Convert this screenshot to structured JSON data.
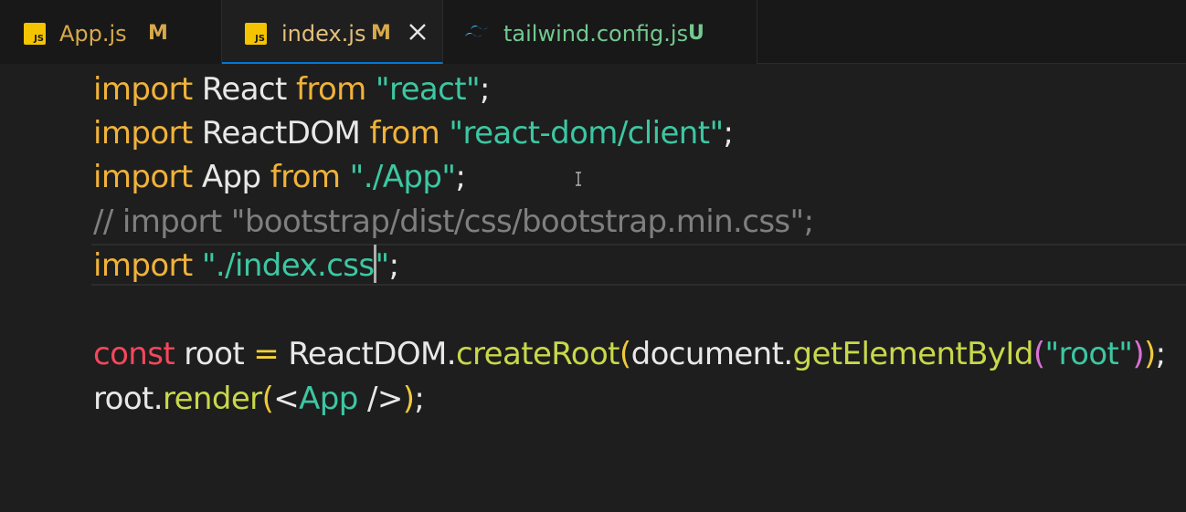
{
  "tabs": [
    {
      "label": "App.js",
      "status": "M",
      "icon": "js-icon",
      "active": false
    },
    {
      "label": "index.js",
      "status": "M",
      "icon": "js-icon",
      "active": true
    },
    {
      "label": "tailwind.config.js",
      "status": "U",
      "icon": "tailwind-icon",
      "active": false
    }
  ],
  "colors": {
    "status_modified": "#d7a94b",
    "status_untracked": "#73c991",
    "tab_label_inactive": "#d7a94b",
    "tab_label_active": "#e3c07a",
    "tab_label_untracked": "#73c991",
    "active_tab_underline": "#0078d4"
  },
  "code": {
    "line1": [
      "import",
      " React ",
      "from",
      " ",
      "\"react\"",
      ";"
    ],
    "line2": [
      "import",
      " ReactDOM ",
      "from",
      " ",
      "\"react-dom/client\"",
      ";"
    ],
    "line3": [
      "import",
      " App ",
      "from",
      " ",
      "\"./App\"",
      ";"
    ],
    "line4": "// import \"bootstrap/dist/css/bootstrap.min.css\";",
    "line5": [
      "import",
      " ",
      "\"./index.css",
      "\"",
      ";"
    ],
    "line7": [
      "const",
      " root ",
      "=",
      " ReactDOM.",
      "createRoot",
      "(",
      "document.",
      "getElementById",
      "(",
      "\"root\"",
      ")",
      ")",
      ";"
    ],
    "line8": [
      "root.",
      "render",
      "(",
      "<",
      "App",
      " />",
      ")",
      ";"
    ]
  }
}
